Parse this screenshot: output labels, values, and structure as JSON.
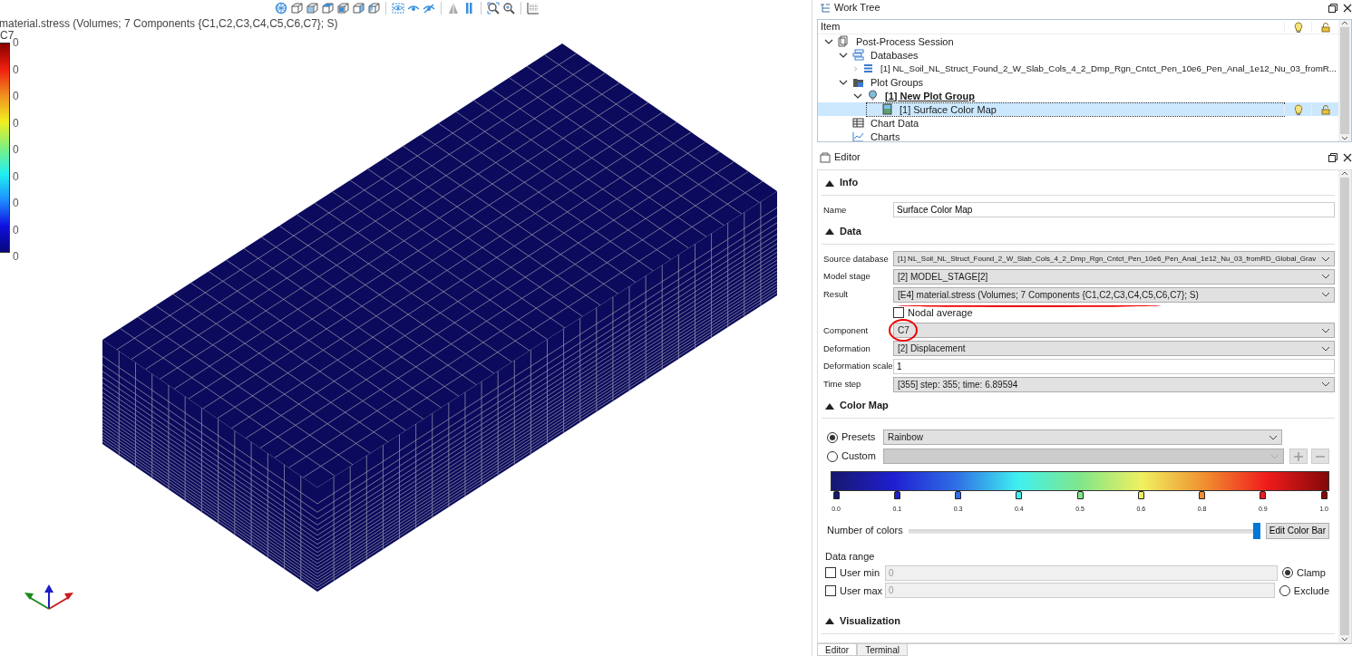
{
  "viewport": {
    "legend": {
      "title": "material.stress (Volumes; 7 Components {C1,C2,C3,C4,C5,C6,C7}; S)",
      "component": "C7",
      "labels": [
        "0",
        "0",
        "0",
        "0",
        "0",
        "0",
        "0",
        "0",
        "0"
      ]
    }
  },
  "work_tree": {
    "title": "Work Tree",
    "column": "Item",
    "items": [
      {
        "label": "Post-Process Session",
        "kind": "session",
        "expanded": true,
        "selected": false,
        "emphasized": false,
        "children": [
          {
            "label": "Databases",
            "kind": "databases",
            "expanded": true,
            "selected": false,
            "emphasized": false,
            "children": [
              {
                "label": "[1] NL_Soil_NL_Struct_Found_2_W_Slab_Cols_4_2_Dmp_Rgn_Cntct_Pen_10e6_Pen_Anal_1e12_Nu_03_fromR...",
                "kind": "database",
                "expanded": false,
                "selected": false,
                "emphasized": false
              }
            ]
          },
          {
            "label": "Plot Groups",
            "kind": "folder",
            "expanded": true,
            "selected": false,
            "emphasized": false,
            "children": [
              {
                "label": "[1] New Plot Group",
                "kind": "plotgroup",
                "expanded": true,
                "selected": false,
                "emphasized": true,
                "children": [
                  {
                    "label": "[1] Surface Color Map",
                    "kind": "colormap",
                    "selected": true,
                    "emphasized": false,
                    "visible": true,
                    "locked": false
                  }
                ]
              }
            ]
          },
          {
            "label": "Chart Data",
            "kind": "table",
            "selected": false,
            "emphasized": false
          },
          {
            "label": "Charts",
            "kind": "chart",
            "selected": false,
            "emphasized": false
          }
        ]
      }
    ]
  },
  "editor": {
    "title": "Editor",
    "sections": [
      {
        "title": "Info",
        "expanded": true,
        "rows": [
          {
            "kind": "input",
            "label": "Name",
            "value": "Surface Color Map"
          }
        ]
      },
      {
        "title": "Data",
        "expanded": true,
        "rows": [
          {
            "kind": "select",
            "label": "Source database",
            "value": "[1] NL_Soil_NL_Struct_Found_2_W_Slab_Cols_4_2_Dmp_Rgn_Cntct_Pen_10e6_Pen_Anal_1e12_Nu_03_fromRD_Global_Grav"
          },
          {
            "kind": "select",
            "label": "Model stage",
            "value": "[2] MODEL_STAGE[2]"
          },
          {
            "kind": "select",
            "label": "Result",
            "value": "[E4] material.stress (Volumes; 7 Components {C1,C2,C3,C4,C5,C6,C7}; S)",
            "underlined": true
          },
          {
            "kind": "checkbox",
            "label": "Nodal average",
            "checked": false
          },
          {
            "kind": "select",
            "label": "Component",
            "value": "C7",
            "circled": true
          },
          {
            "kind": "select",
            "label": "Deformation",
            "value": "[2] Displacement"
          },
          {
            "kind": "input",
            "label": "Deformation scale",
            "value": "1"
          },
          {
            "kind": "select",
            "label": "Time step",
            "value": "[355] step: 355; time: 6.89594"
          }
        ]
      },
      {
        "title": "Color Map",
        "expanded": true,
        "colormap": {
          "presets": {
            "label": "Presets",
            "selected": true,
            "value": "Rainbow",
            "disabled": false
          },
          "custom": {
            "label": "Custom",
            "selected": false,
            "disabled": true
          },
          "stops": [
            {
              "label": "0.0",
              "color": "#17176e"
            },
            {
              "label": "0.1",
              "color": "#1f1fd0"
            },
            {
              "label": "0.3",
              "color": "#2f6ee6"
            },
            {
              "label": "0.4",
              "color": "#3ff0f0"
            },
            {
              "label": "0.5",
              "color": "#80e68a"
            },
            {
              "label": "0.6",
              "color": "#f0f060"
            },
            {
              "label": "0.8",
              "color": "#f09030"
            },
            {
              "label": "0.9",
              "color": "#f01c1c"
            },
            {
              "label": "1.0",
              "color": "#840808"
            }
          ],
          "number_of_colors": {
            "label": "Number of colors",
            "level": 1
          },
          "edit_button": "Edit Color Bar",
          "data_range": {
            "title": "Data range",
            "rows": [
              {
                "label": "User min",
                "checked": false,
                "value": "0"
              },
              {
                "label": "User max",
                "checked": false,
                "value": "0"
              }
            ],
            "modes": [
              {
                "label": "Clamp",
                "selected": true
              },
              {
                "label": "Exclude",
                "selected": false
              }
            ]
          }
        }
      },
      {
        "title": "Visualization",
        "expanded": true
      }
    ]
  },
  "bottom_tabs": [
    {
      "label": "Editor",
      "selected": true
    },
    {
      "label": "Terminal",
      "selected": false
    }
  ]
}
